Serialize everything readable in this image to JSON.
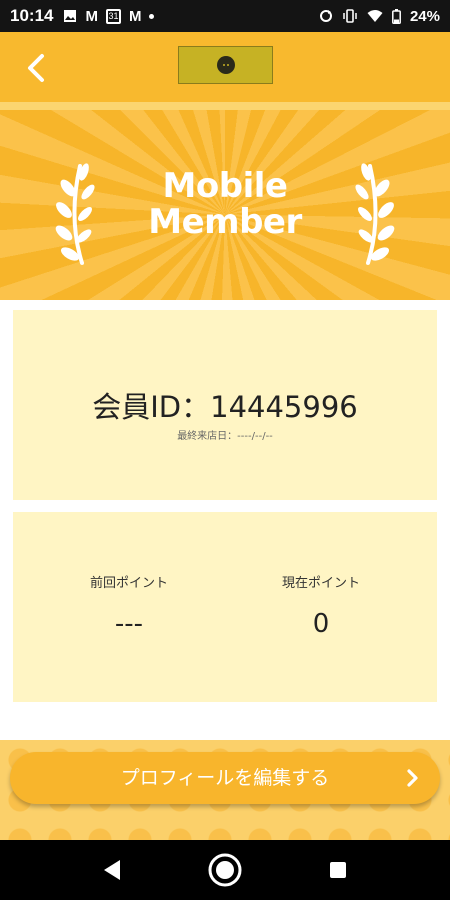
{
  "status_bar": {
    "time": "10:14",
    "left_icons": [
      "image-icon",
      "gmail-icon",
      "calendar-icon",
      "gmail-icon",
      "notification-dot-icon"
    ],
    "calendar_day": "31",
    "mail_glyph": "M",
    "right_icons": [
      "sync-icon",
      "vibrate-icon",
      "wifi-icon",
      "battery-icon"
    ],
    "battery": "24%"
  },
  "header": {
    "back_icon": "chevron-left-icon",
    "logo": "shop-logo"
  },
  "banner": {
    "title_line1": "Mobile",
    "title_line2": "Member",
    "decor_icon": "laurel-icon"
  },
  "member_card": {
    "member_id": "会員ID：14445996",
    "last_visit": "最終来店日：----/--/--"
  },
  "points": {
    "previous_label": "前回ポイント",
    "previous_value": "---",
    "current_label": "現在ポイント",
    "current_value": "0"
  },
  "actions": {
    "edit_profile_label": "プロフィールを編集する",
    "edit_profile_icon": "chevron-right-icon"
  },
  "nav_bar": {
    "icons": [
      "back-triangle-icon",
      "home-circle-icon",
      "recents-square-icon"
    ]
  },
  "colors": {
    "primary": "#f8b92e",
    "card_bg": "#fff5c4",
    "status_bar": "#141414"
  }
}
